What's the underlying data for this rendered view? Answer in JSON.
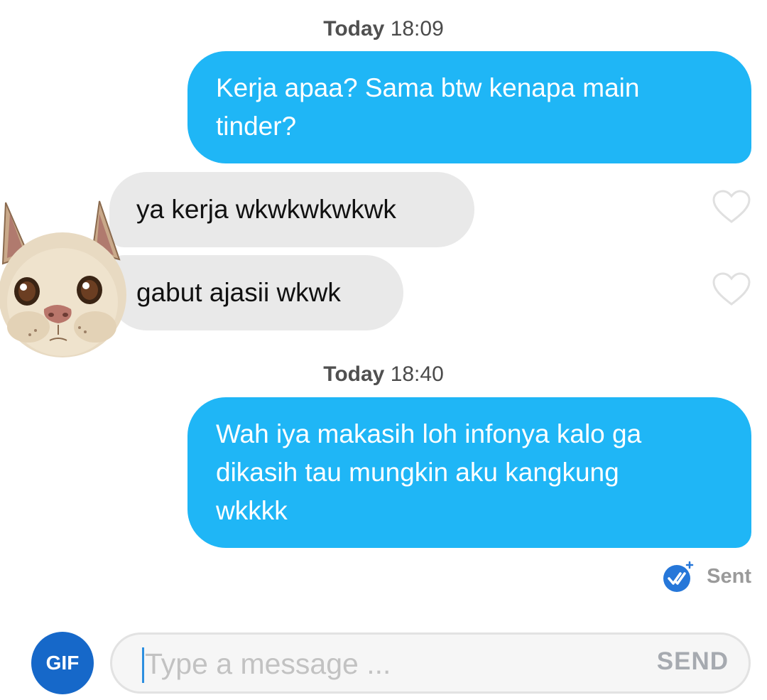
{
  "messages": [
    {
      "type": "timestamp",
      "day": "Today",
      "time": "18:09"
    },
    {
      "type": "outgoing",
      "lines": [
        "Kerja apaa? Sama btw kenapa main",
        "tinder?"
      ]
    },
    {
      "type": "incoming",
      "text": "ya kerja wkwkwkwkwk",
      "liked": false
    },
    {
      "type": "incoming",
      "text": "gabut ajasii wkwk",
      "liked": false
    },
    {
      "type": "timestamp",
      "day": "Today",
      "time": "18:40"
    },
    {
      "type": "outgoing",
      "lines": [
        "Wah iya makasih loh infonya kalo ga",
        "dikasih tau mungkin aku kangkung",
        "wkkkk"
      ]
    }
  ],
  "status": {
    "label": "Sent",
    "icon": "double-check-icon"
  },
  "composer": {
    "gif_label": "GIF",
    "placeholder": "Type a message ...",
    "value": "",
    "send_label": "SEND"
  },
  "colors": {
    "outgoing_bubble": "#1fb6f6",
    "incoming_bubble": "#e9e9e9",
    "gif_button": "#1668c9",
    "sent_check": "#2677d9"
  }
}
